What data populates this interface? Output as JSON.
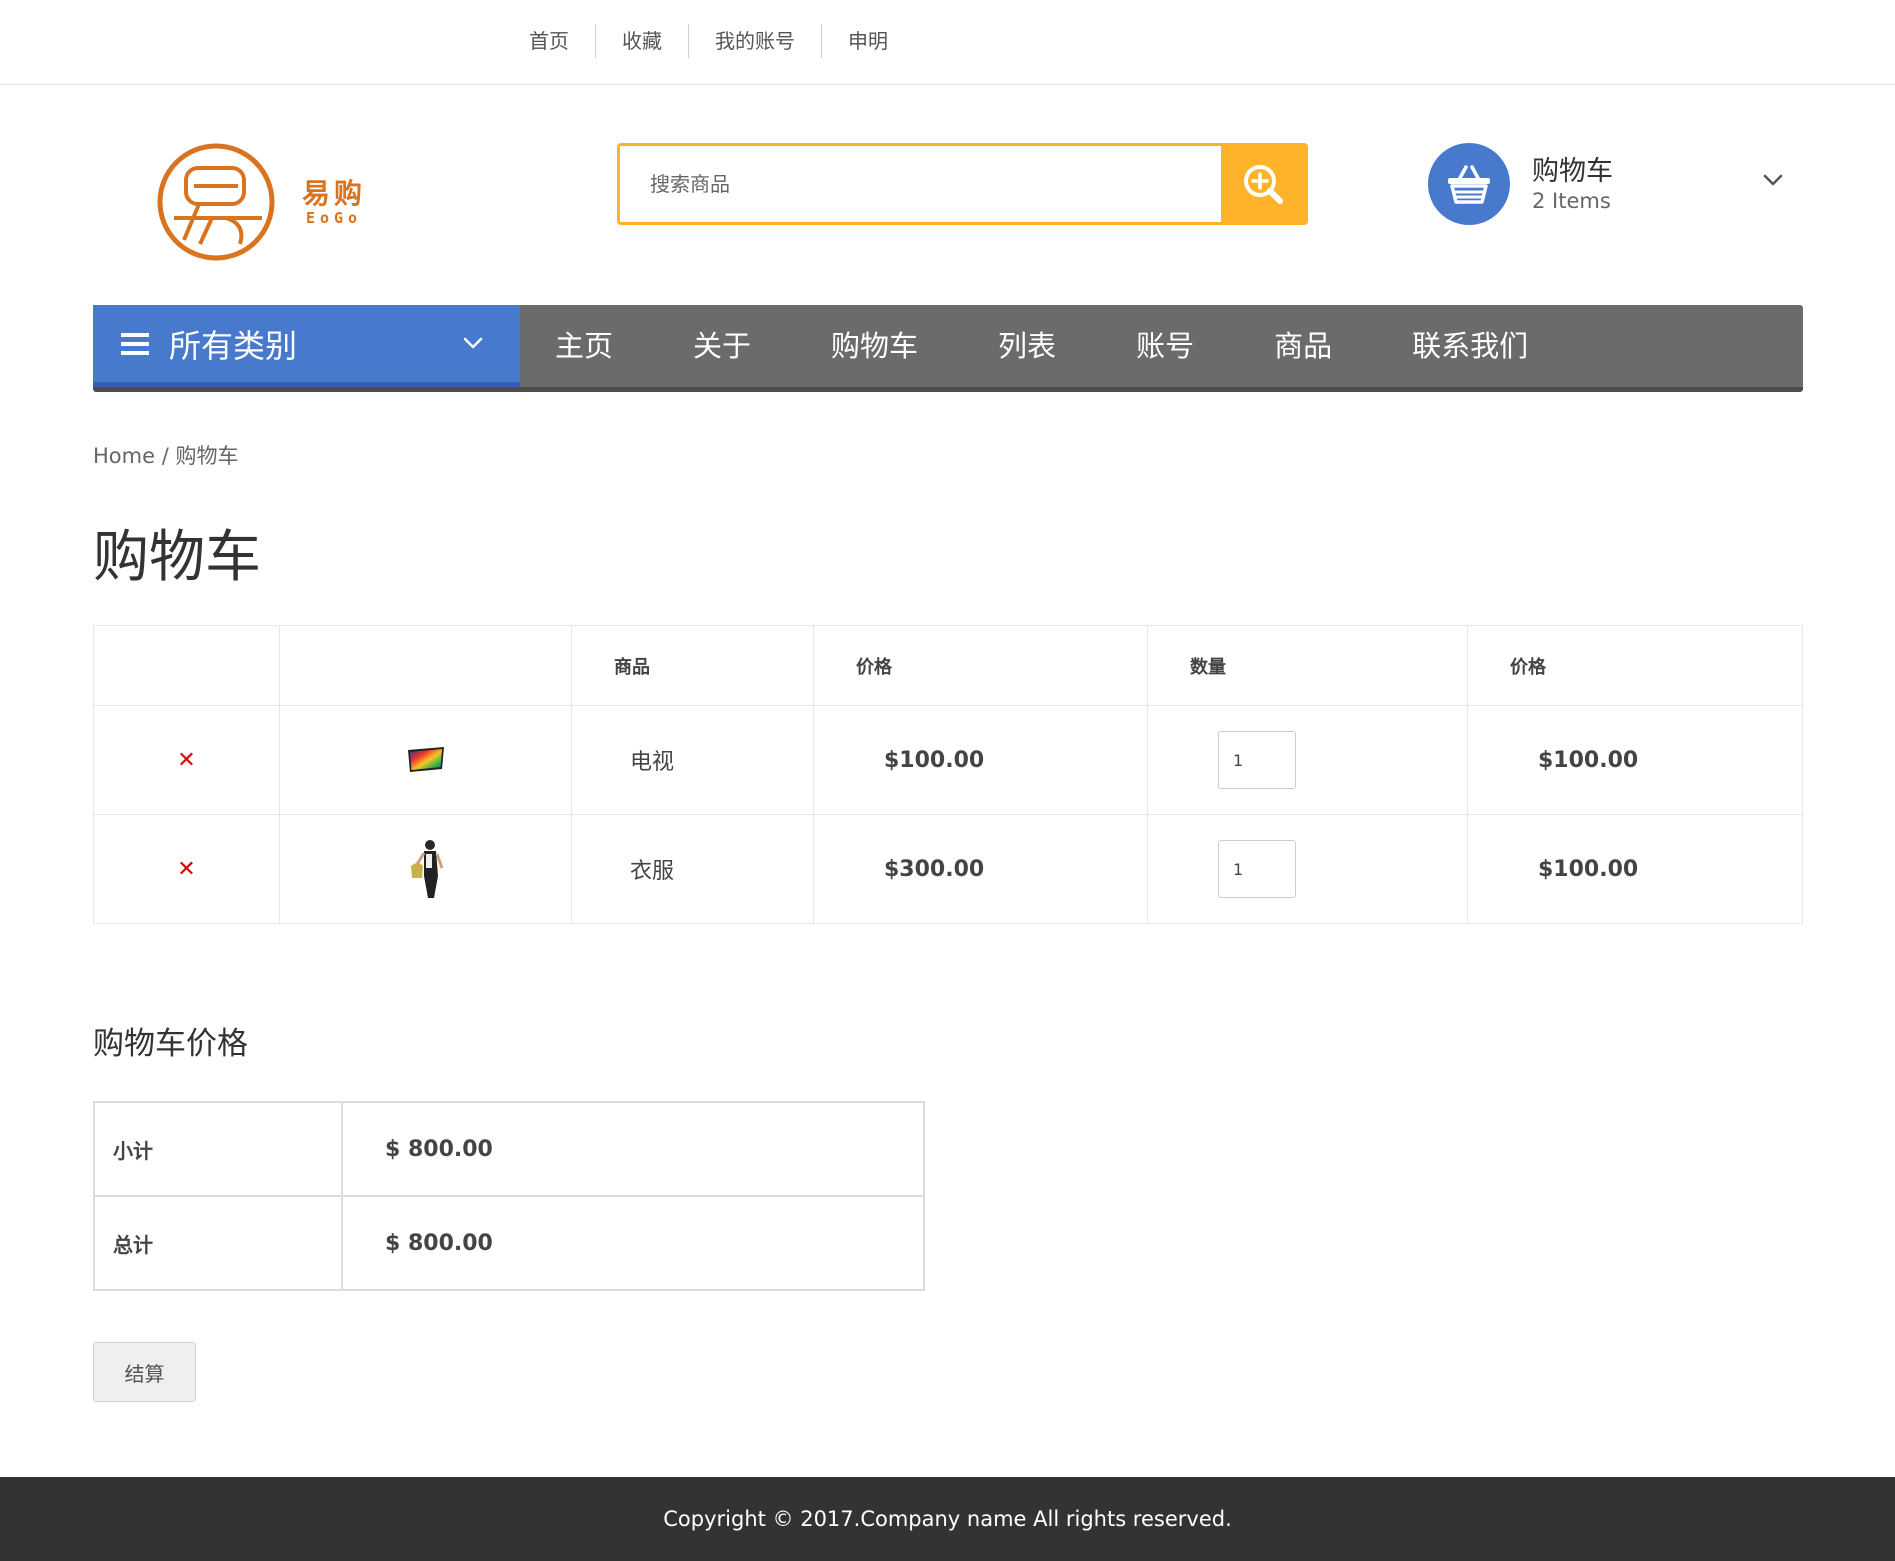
{
  "topbar": {
    "links": [
      "首页",
      "收藏",
      "我的账号",
      "申明"
    ]
  },
  "logo": {
    "cn": "易购",
    "en": "EoGo",
    "color": "#d9731e"
  },
  "search": {
    "placeholder": "搜索商品",
    "button_color": "#ffb32b",
    "icon": "search-plus-icon"
  },
  "cart_widget": {
    "title": "购物车",
    "count": "2 Items",
    "icon": "basket-icon",
    "color": "#4779cc"
  },
  "mainnav": {
    "all_categories": "所有类别",
    "items": [
      "主页",
      "关于",
      "购物车",
      "列表",
      "账号",
      "商品",
      "联系我们"
    ]
  },
  "breadcrumb": {
    "home": "Home",
    "separator": "/",
    "current": "购物车"
  },
  "page": {
    "title": "购物车"
  },
  "cart_table": {
    "headers": [
      "",
      "",
      "商品",
      "价格",
      "数量",
      "价格"
    ],
    "rows": [
      {
        "name": "电视",
        "price": "$100.00",
        "qty": "1",
        "total": "$100.00",
        "thumb": "tv-thumbnail"
      },
      {
        "name": "衣服",
        "price": "$300.00",
        "qty": "1",
        "total": "$100.00",
        "thumb": "clothing-thumbnail"
      }
    ]
  },
  "totals": {
    "title": "购物车价格",
    "subtotal_label": "小计",
    "subtotal_value": "$ 800.00",
    "total_label": "总计",
    "total_value": "$ 800.00"
  },
  "checkout": {
    "label": "结算"
  },
  "footer": {
    "text": "Copyright © 2017.Company name All rights reserved."
  }
}
